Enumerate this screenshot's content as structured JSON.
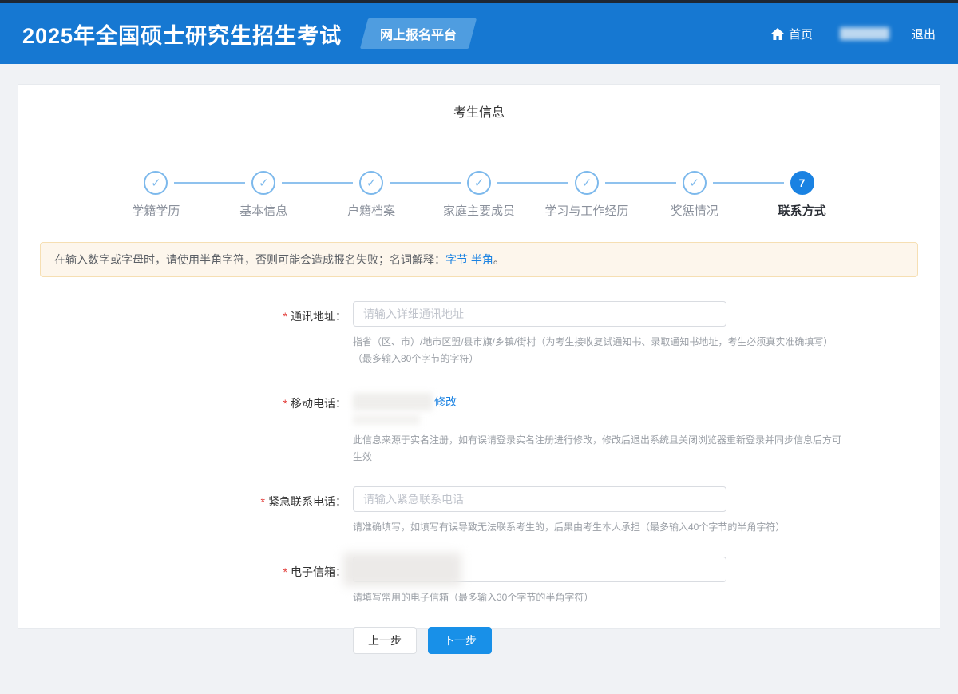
{
  "header": {
    "title": "2025年全国硕士研究生招生考试",
    "badge": "网上报名平台",
    "home_label": "首页",
    "logout_label": "退出"
  },
  "card": {
    "title": "考生信息"
  },
  "steps": [
    {
      "label": "学籍学历",
      "state": "done"
    },
    {
      "label": "基本信息",
      "state": "done"
    },
    {
      "label": "户籍档案",
      "state": "done"
    },
    {
      "label": "家庭主要成员",
      "state": "done"
    },
    {
      "label": "学习与工作经历",
      "state": "done"
    },
    {
      "label": "奖惩情况",
      "state": "done"
    },
    {
      "label": "联系方式",
      "state": "current",
      "number": "7"
    }
  ],
  "icons": {
    "check": "✓"
  },
  "notice": {
    "prefix": "在输入数字或字母时，请使用半角字符，否则可能会造成报名失败；名词解释：",
    "link1": "字节",
    "link2": "半角",
    "suffix": "。"
  },
  "form": {
    "required_mark": "*",
    "address": {
      "label": "通讯地址：",
      "placeholder": "请输入详细通讯地址",
      "value": "",
      "help1": "指省（区、市）/地市区盟/县市旗/乡镇/街村（为考生接收复试通知书、录取通知书地址，考生必须真实准确填写）",
      "help2": "（最多输入80个字节的字符）"
    },
    "mobile": {
      "label": "移动电话：",
      "modify_link": "修改",
      "help": "此信息来源于实名注册，如有误请登录实名注册进行修改，修改后退出系统且关闭浏览器重新登录并同步信息后方可生效"
    },
    "emergency": {
      "label": "紧急联系电话：",
      "placeholder": "请输入紧急联系电话",
      "value": "",
      "help": "请准确填写，如填写有误导致无法联系考生的，后果由考生本人承担（最多输入40个字节的半角字符）"
    },
    "email": {
      "label": "电子信箱：",
      "value": "",
      "help": "请填写常用的电子信箱（最多输入30个字节的半角字符）"
    },
    "buttons": {
      "prev": "上一步",
      "next": "下一步"
    }
  },
  "colors": {
    "header_blue": "#1678d2",
    "badge_blue": "#4f9de0",
    "accent_blue": "#1a82e2",
    "step_done_blue": "#7db9ec",
    "notice_bg": "#fdf6ec",
    "notice_border": "#f6dfb3",
    "required_red": "#e23c39",
    "next_button_blue": "#1890e8"
  }
}
